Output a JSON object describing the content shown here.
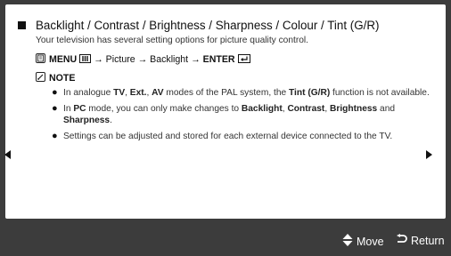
{
  "heading": "Backlight / Contrast / Brightness / Sharpness / Colour / Tint (G/R)",
  "intro": "Your television has several setting options for picture quality control.",
  "path": {
    "menu": "MENU",
    "sep": "→",
    "picture": "Picture",
    "backlight": "Backlight",
    "enter": "ENTER"
  },
  "note_label": "NOTE",
  "notes": [
    {
      "a": "In analogue ",
      "b1": "TV",
      "c": ", ",
      "b2": "Ext.",
      "d": ", ",
      "b3": "AV",
      "e": " modes of the PAL system, the ",
      "b4": "Tint (G/R)",
      "f": " function is not available."
    },
    {
      "a": "In ",
      "b1": "PC",
      "c": " mode, you can only make changes to ",
      "b2": "Backlight",
      "d": ", ",
      "b3": "Contrast",
      "e": ", ",
      "b4": "Brightness",
      "f": " and ",
      "b5": "Sharpness",
      "g": "."
    },
    {
      "text": "Settings can be adjusted and stored for each external device connected to the TV."
    }
  ],
  "footer": {
    "move_label": "Move",
    "return_label": "Return"
  },
  "colors": {
    "background": "#3c3c3c",
    "panel": "#ffffff",
    "text": "#333333"
  }
}
